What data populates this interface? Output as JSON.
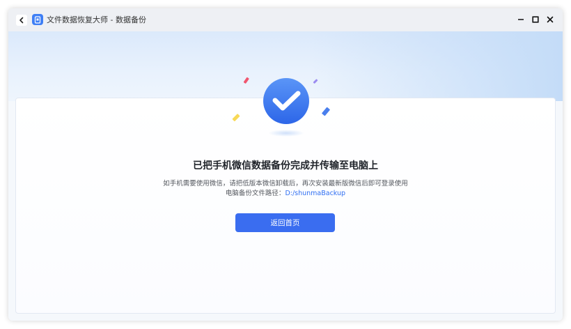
{
  "window": {
    "title": "文件数据恢复大师 - 数据备份"
  },
  "result": {
    "heading": "已把手机微信数据备份完成并传输至电脑上",
    "desc_line1": "如手机需要使用微信，请把低版本微信卸载后，再次安装最新版微信后即可登录使用",
    "desc_line2_prefix": "电脑备份文件路径：",
    "backup_path": "D:/shunmaBackup",
    "home_button_label": "返回首页"
  },
  "icons": {
    "back": "chevron-left-icon",
    "app": "file-recovery-app-icon",
    "minimize": "minimize-icon",
    "maximize": "maximize-icon",
    "close": "close-icon",
    "success": "checkmark-icon"
  },
  "colors": {
    "accent": "#3a6df0",
    "link": "#2f6ff2",
    "success_badge": "#3d7cf0"
  }
}
